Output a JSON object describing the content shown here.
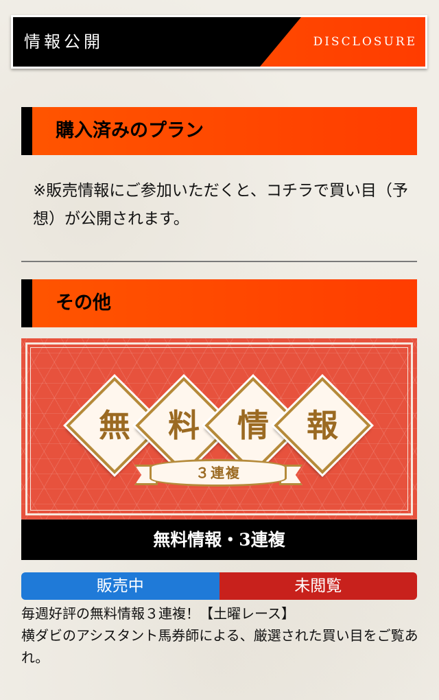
{
  "header": {
    "title": "情報公開",
    "subtitle": "DISCLOSURE"
  },
  "purchased": {
    "heading": "購入済みのプラン",
    "note": "※販売情報にご参加いただくと、コチラで買い目（予想）が公開されます。"
  },
  "other": {
    "heading": "その他",
    "banner": {
      "chars": [
        "無",
        "料",
        "情",
        "報"
      ],
      "ribbon": "３連複"
    },
    "caption": "無料情報・3連複",
    "status_left": "販売中",
    "status_right": "未閲覧",
    "description_line1": "毎週好評の無料情報３連複！【土曜レース】",
    "description_line2": "横ダビのアシスタント馬券師による、厳選された買い目をご覧あれ。"
  },
  "colors": {
    "accent_orange": "#ff4a00",
    "sale_blue": "#1f7ad8",
    "unread_red": "#c8211c",
    "banner_red": "#e7523d",
    "gold": "#b58a3a"
  }
}
